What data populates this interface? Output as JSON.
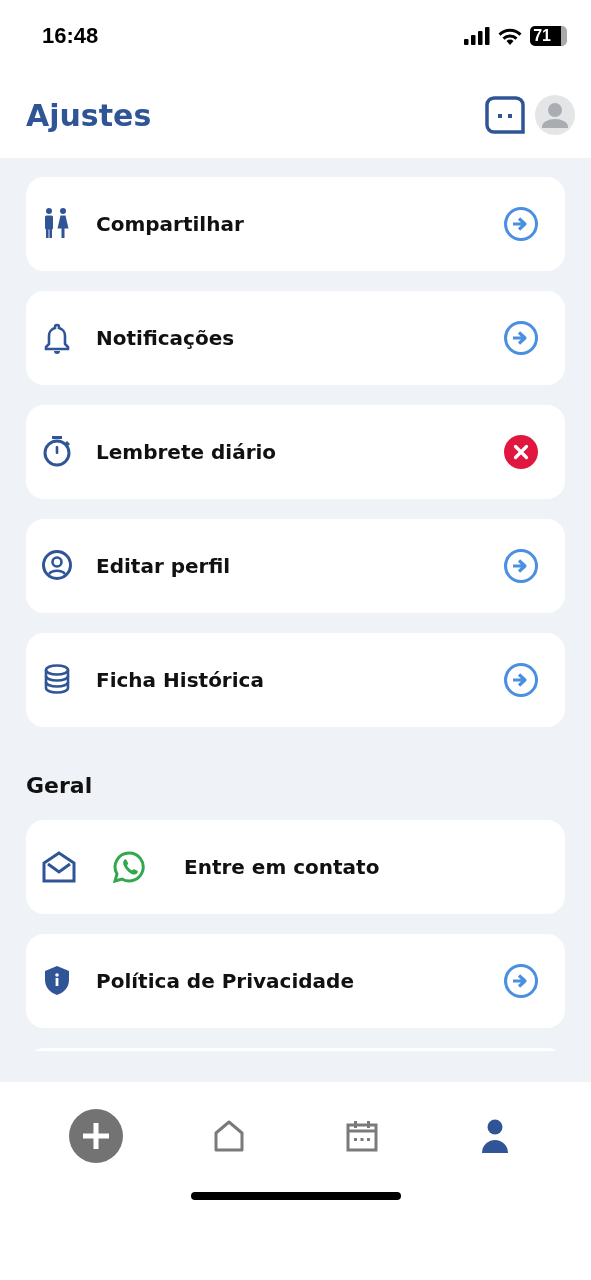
{
  "status_bar": {
    "time": "16:48",
    "battery": "71"
  },
  "header": {
    "title": "Ajustes"
  },
  "items": [
    {
      "label": "Compartilhar",
      "kind": "link"
    },
    {
      "label": "Notificações",
      "kind": "link"
    },
    {
      "label": "Lembrete diário",
      "kind": "removable"
    },
    {
      "label": "Editar perfil",
      "kind": "link"
    },
    {
      "label": "Ficha Histórica",
      "kind": "link"
    }
  ],
  "section": {
    "title": "Geral",
    "items": [
      {
        "label": "Entre em contato",
        "kind": "contact"
      },
      {
        "label": "Política de Privacidade",
        "kind": "link"
      }
    ]
  },
  "nav": [
    {
      "selected": false
    },
    {
      "selected": false
    },
    {
      "selected": false
    },
    {
      "selected": true
    }
  ]
}
